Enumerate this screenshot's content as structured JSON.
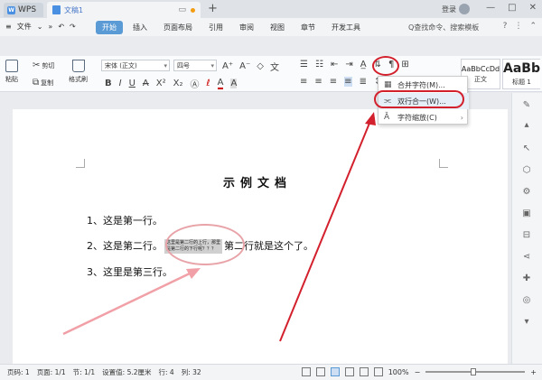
{
  "titlebar": {
    "app_tab": "WPS",
    "doc_tab": "文稿1",
    "plus": "+",
    "login": "登录",
    "window_controls": [
      "—",
      "□",
      "✕"
    ]
  },
  "menubar": {
    "file_label": "文件",
    "items": [
      {
        "label": "开始",
        "active": true
      },
      {
        "label": "插入"
      },
      {
        "label": "页面布局"
      },
      {
        "label": "引用"
      },
      {
        "label": "审阅"
      },
      {
        "label": "视图"
      },
      {
        "label": "章节"
      },
      {
        "label": "开发工具"
      }
    ],
    "search_placeholder": "Q查找命令、搜索模板",
    "help": "?"
  },
  "ribbon": {
    "paste": "粘贴",
    "cut": "剪切",
    "copy": "复制",
    "format_painter": "格式刷",
    "font_name": "宋体 (正文)",
    "font_size": "四号",
    "bold": "B",
    "italic": "I",
    "underline": "U",
    "strike": "A",
    "superscript": "X²",
    "subscript": "X₂",
    "style_normal_sample": "AaBbCcDd",
    "style_normal_label": "正文",
    "style_heading_sample": "AaBb",
    "style_heading_label": "标题 1"
  },
  "dropdown": {
    "items": [
      {
        "icon": "merge-chars-icon",
        "label": "合并字符(M)..."
      },
      {
        "icon": "two-lines-in-one-icon",
        "label": "双行合一(W)..."
      },
      {
        "icon": "char-scale-icon",
        "label": "字符缩放(C)"
      }
    ]
  },
  "document": {
    "title": "示例文档",
    "line1": "1、这是第一行。",
    "line2_prefix": "2、这是第二行。",
    "two_line_top": "这里是第二行的上行，那里",
    "two_line_bottom": "是第二行的下行呢？？？",
    "line2_suffix": "第二行就是这个了。",
    "line3": "3、这里是第三行。"
  },
  "statusbar": {
    "page_num": "页码: 1",
    "page": "页面: 1/1",
    "section": "节: 1/1",
    "setting": "设置值: 5.2厘米",
    "row": "行: 4",
    "col": "列: 32",
    "zoom": "100%",
    "zoom_minus": "−",
    "zoom_plus": "+"
  },
  "colors": {
    "accent": "#5b9bd5",
    "highlight_red": "#d3202d",
    "pink_oval": "#e8a3a8"
  }
}
